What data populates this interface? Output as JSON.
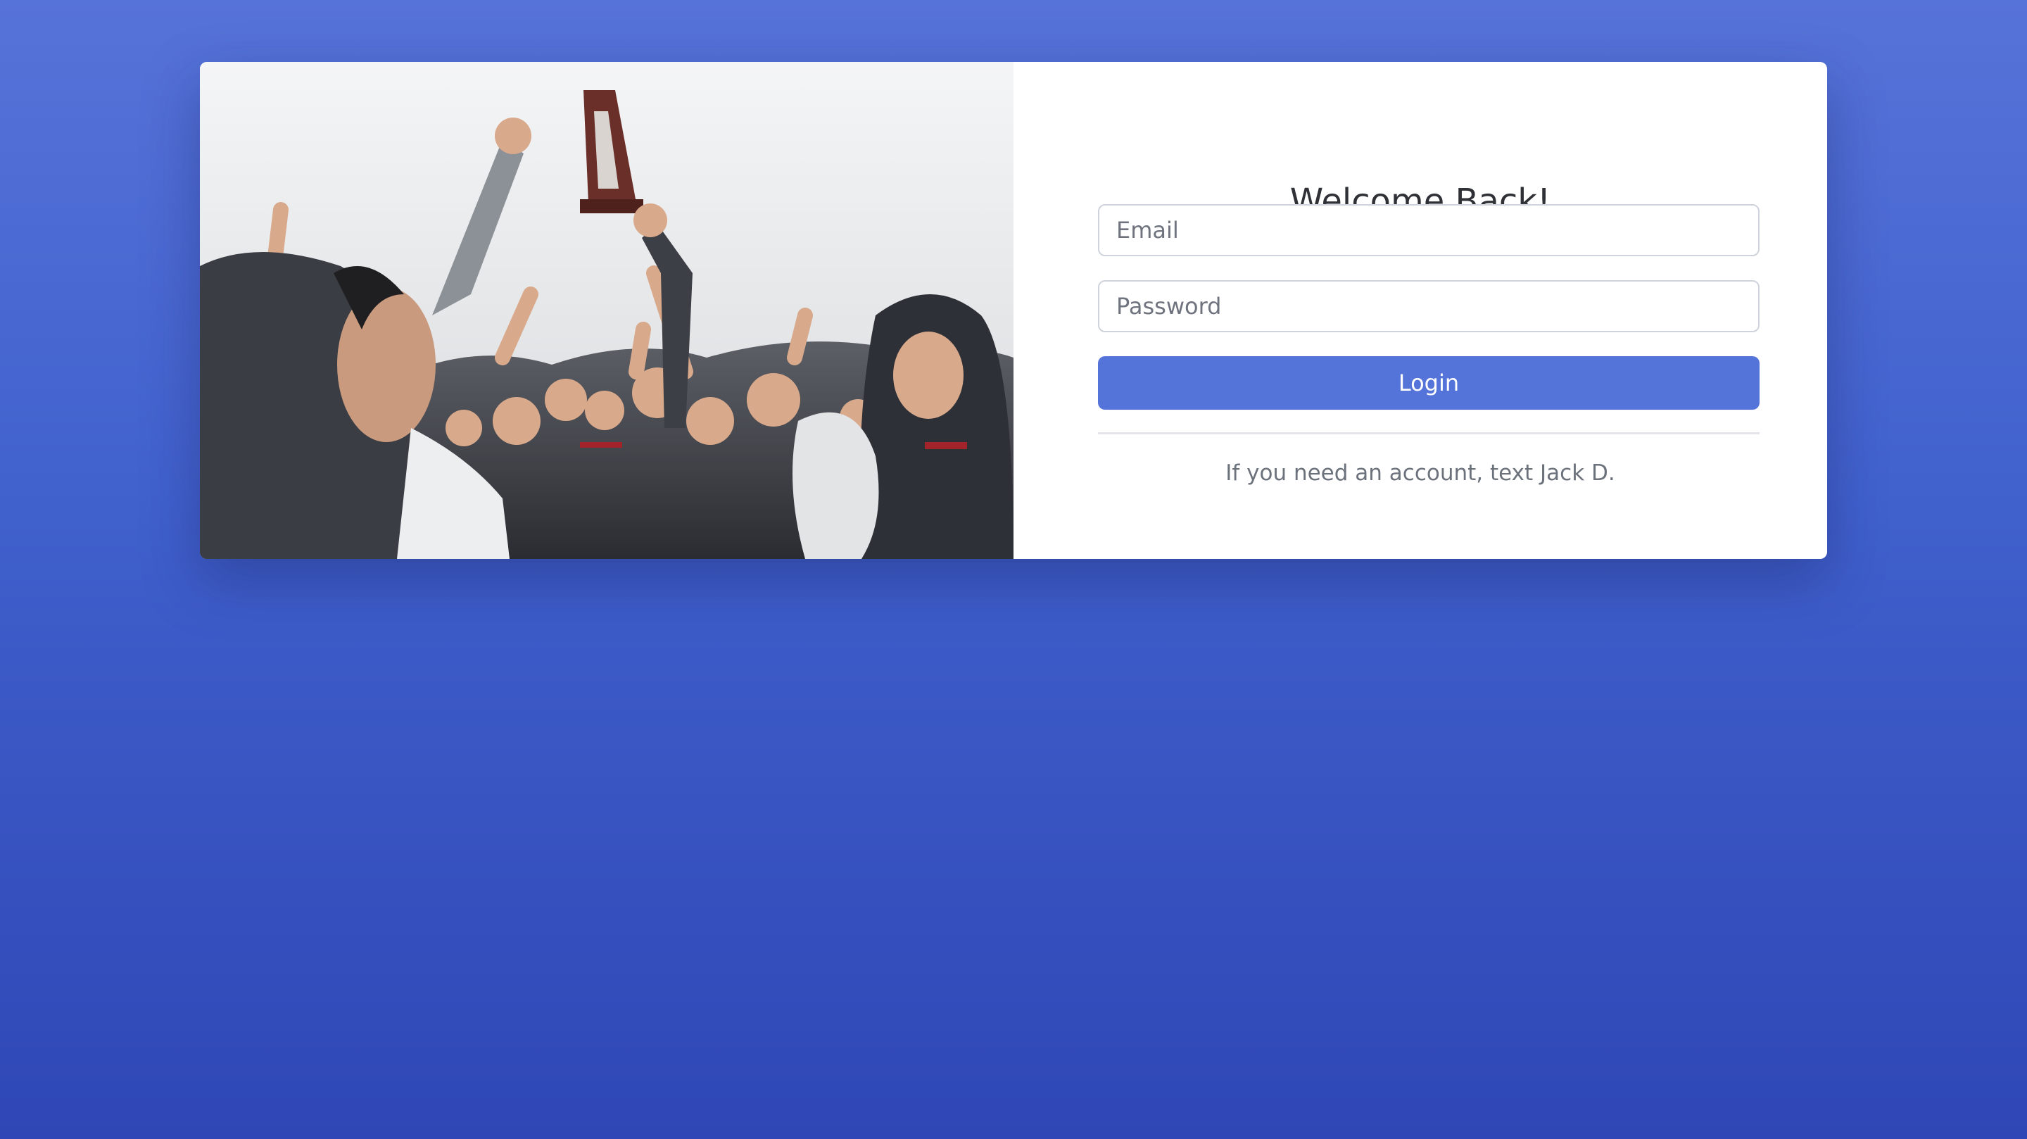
{
  "login": {
    "title": "Welcome Back!",
    "email_placeholder": "Email",
    "password_placeholder": "Password",
    "login_label": "Login",
    "account_hint": "If you need an account, text Jack D."
  },
  "colors": {
    "background_top": "#5673d9",
    "background_bottom": "#2f47b6",
    "button": "#5574d9"
  }
}
